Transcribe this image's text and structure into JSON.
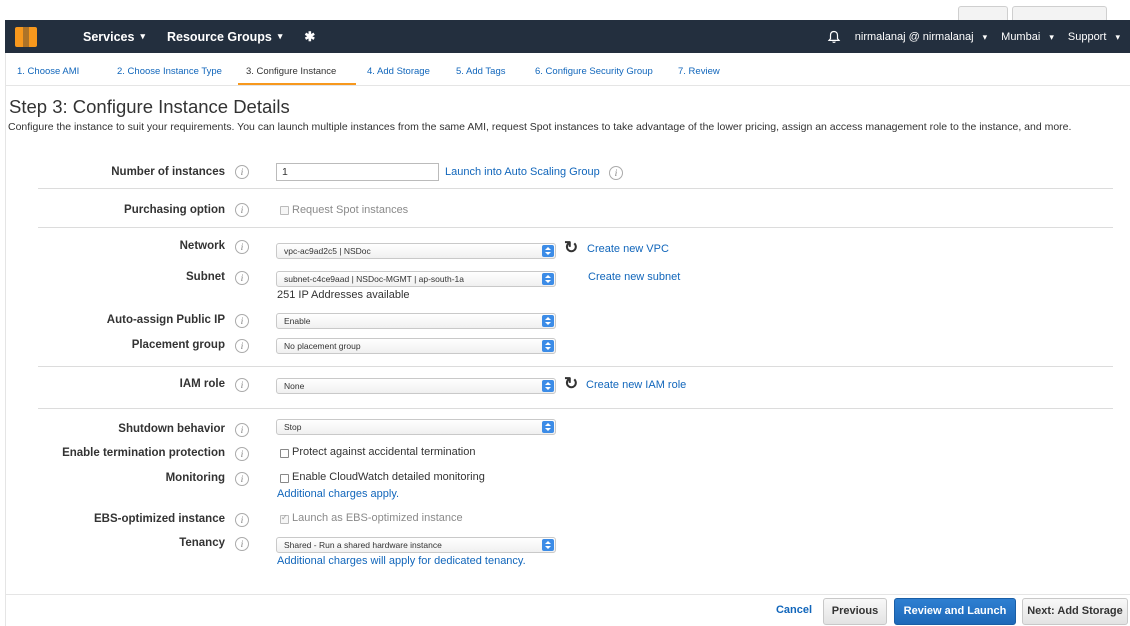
{
  "navbar": {
    "services_label": "Services",
    "resource_groups_label": "Resource Groups",
    "user_label": "nirmalanaj @ nirmalanaj",
    "region_label": "Mumbai",
    "support_label": "Support",
    "icons": [
      "aws-logo-icon",
      "pin-icon",
      "bell-icon",
      "chevron-down-icon"
    ],
    "colors": {
      "bar": "#232f3e",
      "logo": "#f7981d"
    }
  },
  "tabs": [
    {
      "label": "1. Choose AMI"
    },
    {
      "label": "2. Choose Instance Type"
    },
    {
      "label": "3. Configure Instance",
      "active": true
    },
    {
      "label": "4. Add Storage"
    },
    {
      "label": "5. Add Tags"
    },
    {
      "label": "6. Configure Security Group"
    },
    {
      "label": "7. Review"
    }
  ],
  "page": {
    "title": "Step 3: Configure Instance Details",
    "description": "Configure the instance to suit your requirements. You can launch multiple instances from the same AMI, request Spot instances to take advantage of the lower pricing, assign an access management role to the instance, and more."
  },
  "form": {
    "instances": {
      "label": "Number of instances",
      "value": "1",
      "link": "Launch into Auto Scaling Group"
    },
    "purchasing": {
      "label": "Purchasing option",
      "checkbox_label": "Request Spot instances",
      "checked": false,
      "disabled": true
    },
    "network": {
      "label": "Network",
      "value": "vpc-ac9ad2c5 | NSDoc",
      "link": "Create new VPC"
    },
    "subnet": {
      "label": "Subnet",
      "value": "subnet-c4ce9aad | NSDoc-MGMT | ap-south-1a",
      "link": "Create new subnet",
      "note": "251 IP Addresses available"
    },
    "public_ip": {
      "label": "Auto-assign Public IP",
      "value": "Enable"
    },
    "placement": {
      "label": "Placement group",
      "value": "No placement group"
    },
    "iam": {
      "label": "IAM role",
      "value": "None",
      "link": "Create new IAM role"
    },
    "shutdown": {
      "label": "Shutdown behavior",
      "value": "Stop"
    },
    "termination": {
      "label": "Enable termination protection",
      "checkbox_label": "Protect against accidental termination",
      "checked": false
    },
    "monitoring": {
      "label": "Monitoring",
      "checkbox_label": "Enable CloudWatch detailed monitoring",
      "checked": false,
      "note": "Additional charges apply."
    },
    "ebs": {
      "label": "EBS-optimized instance",
      "checkbox_label": "Launch as EBS-optimized instance",
      "checked": true,
      "disabled": true
    },
    "tenancy": {
      "label": "Tenancy",
      "value": "Shared - Run a shared hardware instance",
      "note": "Additional charges will apply for dedicated tenancy."
    }
  },
  "buttons": {
    "cancel": "Cancel",
    "previous": "Previous",
    "review_launch": "Review and Launch",
    "next": "Next: Add Storage"
  },
  "colors": {
    "link": "#1166bb",
    "primary_button": "#1d69b9",
    "tab_active_underline": "#f7981d"
  }
}
